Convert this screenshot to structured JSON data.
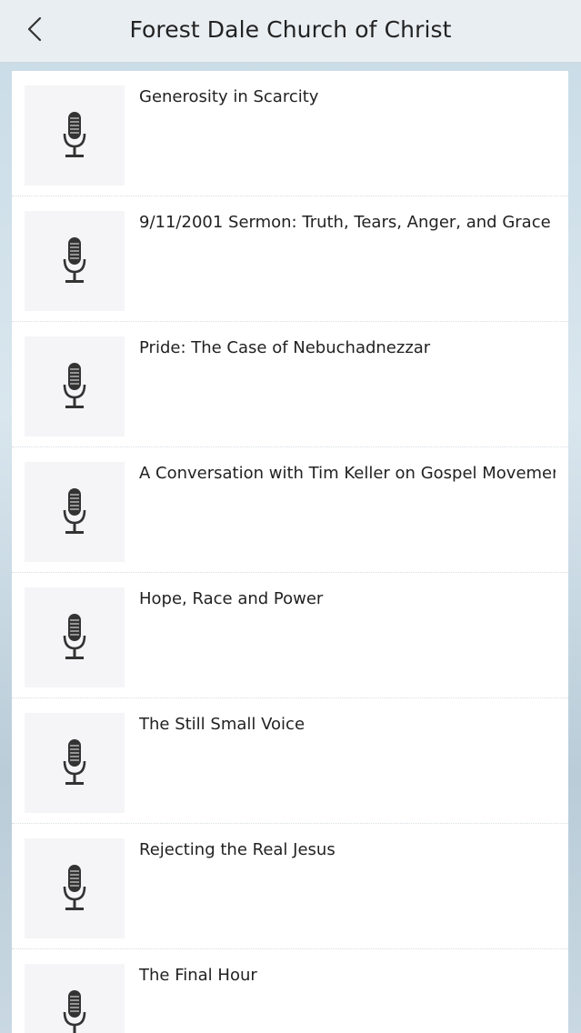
{
  "header": {
    "title": "Forest Dale Church of Christ",
    "back_icon": "chevron-left-icon"
  },
  "items": [
    {
      "title": "Generosity in Scarcity",
      "icon": "microphone-icon"
    },
    {
      "title": "9/11/2001 Sermon: Truth, Tears, Anger, and Grace",
      "icon": "microphone-icon"
    },
    {
      "title": "Pride: The Case of Nebuchadnezzar",
      "icon": "microphone-icon"
    },
    {
      "title": "A Conversation with Tim Keller on Gospel Movements",
      "icon": "microphone-icon"
    },
    {
      "title": "Hope, Race and Power",
      "icon": "microphone-icon"
    },
    {
      "title": "The Still Small Voice",
      "icon": "microphone-icon"
    },
    {
      "title": "Rejecting the Real Jesus",
      "icon": "microphone-icon"
    },
    {
      "title": "The Final Hour",
      "icon": "microphone-icon"
    }
  ]
}
